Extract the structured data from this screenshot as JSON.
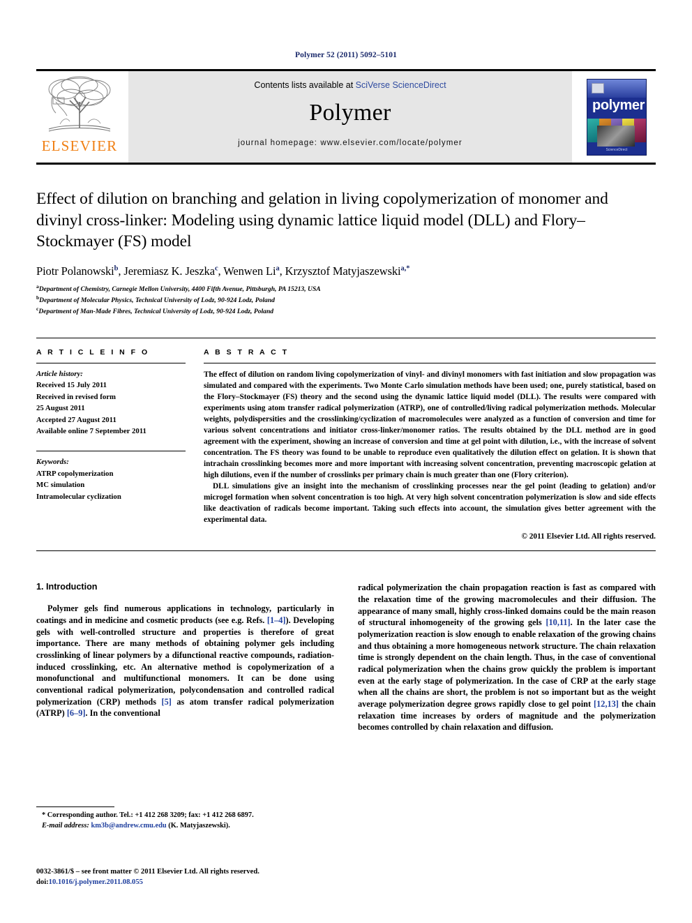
{
  "running_head": "Polymer 52 (2011) 5092–5101",
  "masthead": {
    "publisher_name": "ELSEVIER",
    "contents_prefix": "Contents lists available at ",
    "contents_link": "SciVerse ScienceDirect",
    "journal_name": "Polymer",
    "homepage": "journal homepage: www.elsevier.com/locate/polymer",
    "cover_title": "polymer",
    "cover_footer": "ScienceDirect"
  },
  "article": {
    "title": "Effect of dilution on branching and gelation in living copolymerization of monomer and divinyl cross-linker: Modeling using dynamic lattice liquid model (DLL) and Flory–Stockmayer (FS) model",
    "authors_html": "Piotr Polanowski<sup>b</sup>, Jeremiasz K. Jeszka<sup>c</sup>, Wenwen Li<sup>a</sup>, Krzysztof Matyjaszewski<sup>a,*</sup>",
    "affiliations": [
      {
        "marker": "a",
        "text": "Department of Chemistry, Carnegie Mellon University, 4400 Fifth Avenue, Pittsburgh, PA 15213, USA"
      },
      {
        "marker": "b",
        "text": "Department of Molecular Physics, Technical University of Lodz, 90-924 Lodz, Poland"
      },
      {
        "marker": "c",
        "text": "Department of Man-Made Fibres, Technical University of Lodz, 90-924 Lodz, Poland"
      }
    ]
  },
  "info": {
    "heading": "A R T I C L E   I N F O",
    "history_label": "Article history:",
    "history": [
      "Received 15 July 2011",
      "Received in revised form",
      "25 August 2011",
      "Accepted 27 August 2011",
      "Available online 7 September 2011"
    ],
    "keywords_label": "Keywords:",
    "keywords": [
      "ATRP copolymerization",
      "MC simulation",
      "Intramolecular cyclization"
    ]
  },
  "abstract": {
    "heading": "A B S T R A C T",
    "paragraphs": [
      "The effect of dilution on random living copolymerization of vinyl- and divinyl monomers with fast initiation and slow propagation was simulated and compared with the experiments. Two Monte Carlo simulation methods have been used; one, purely statistical, based on the Flory–Stockmayer (FS) theory and the second using the dynamic lattice liquid model (DLL). The results were compared with experiments using atom transfer radical polymerization (ATRP), one of controlled/living radical polymerization methods. Molecular weights, polydispersities and the crosslinking/cyclization of macromolecules were analyzed as a function of conversion and time for various solvent concentrations and initiator cross-linker/monomer ratios. The results obtained by the DLL method are in good agreement with the experiment, showing an increase of conversion and time at gel point with dilution, i.e., with the increase of solvent concentration. The FS theory was found to be unable to reproduce even qualitatively the dilution effect on gelation. It is shown that intrachain crosslinking becomes more and more important with increasing solvent concentration, preventing macroscopic gelation at high dilutions, even if the number of crosslinks per primary chain is much greater than one (Flory criterion).",
      "DLL simulations give an insight into the mechanism of crosslinking processes near the gel point (leading to gelation) and/or microgel formation when solvent concentration is too high. At very high solvent concentration polymerization is slow and side effects like deactivation of radicals become important. Taking such effects into account, the simulation gives better agreement with the experimental data."
    ],
    "copyright": "© 2011 Elsevier Ltd. All rights reserved."
  },
  "body": {
    "section_number_title": "1.  Introduction",
    "left_html": "Polymer gels find numerous applications in technology, particularly in coatings and in medicine and cosmetic products (see e.g. Refs. <span class=\"ref\">[1–4]</span>). Developing gels with well-controlled structure and properties is therefore of great importance. There are many methods of obtaining polymer gels including crosslinking of linear polymers by a difunctional reactive compounds, radiation-induced crosslinking, etc. An alternative method is copolymerization of a monofunctional and multifunctional monomers. It can be done using conventional radical polymerization, polycondensation and controlled radical polymerization (CRP) methods <span class=\"ref\">[5]</span> as atom transfer radical polymerization (ATRP) <span class=\"ref\">[6–9]</span>. In the conventional",
    "right_html": "radical polymerization the chain propagation reaction is fast as compared with the relaxation time of the growing macromolecules and their diffusion. The appearance of many small, highly cross-linked domains could be the main reason of structural inhomogeneity of the growing gels <span class=\"ref\">[10,11]</span>. In the later case the polymerization reaction is slow enough to enable relaxation of the growing chains and thus obtaining a more homogeneous network structure. The chain relaxation time is strongly dependent on the chain length. Thus, in the case of conventional radical polymerization when the chains grow quickly the problem is important even at the early stage of polymerization. In the case of CRP at the early stage when all the chains are short, the problem is not so important but as the weight average polymerization degree grows rapidly close to gel point <span class=\"ref\">[12,13]</span> the chain relaxation time increases by orders of magnitude and the polymerization becomes controlled by chain relaxation and diffusion."
  },
  "footnotes": {
    "corresponding_html": "* Corresponding author. Tel.: +1 412 268 3209; fax: +1 412 268 6897.",
    "email_html": "<span class=\"it\">E-mail address:</span> <span class=\"mail\">km3b@andrew.cmu.edu</span> (K. Matyjaszewski)."
  },
  "imprint": {
    "issn_line": "0032-3861/$ – see front matter © 2011 Elsevier Ltd. All rights reserved.",
    "doi_label": "doi:",
    "doi_value": "10.1016/j.polymer.2011.08.055"
  },
  "colors": {
    "link_blue": "#2f4ba0",
    "reference_blue": "#1f3f9e",
    "elsevier_orange": "#f07f13",
    "cover_blue": "#1c2f8f",
    "band_grey": "#e6e6e6"
  }
}
